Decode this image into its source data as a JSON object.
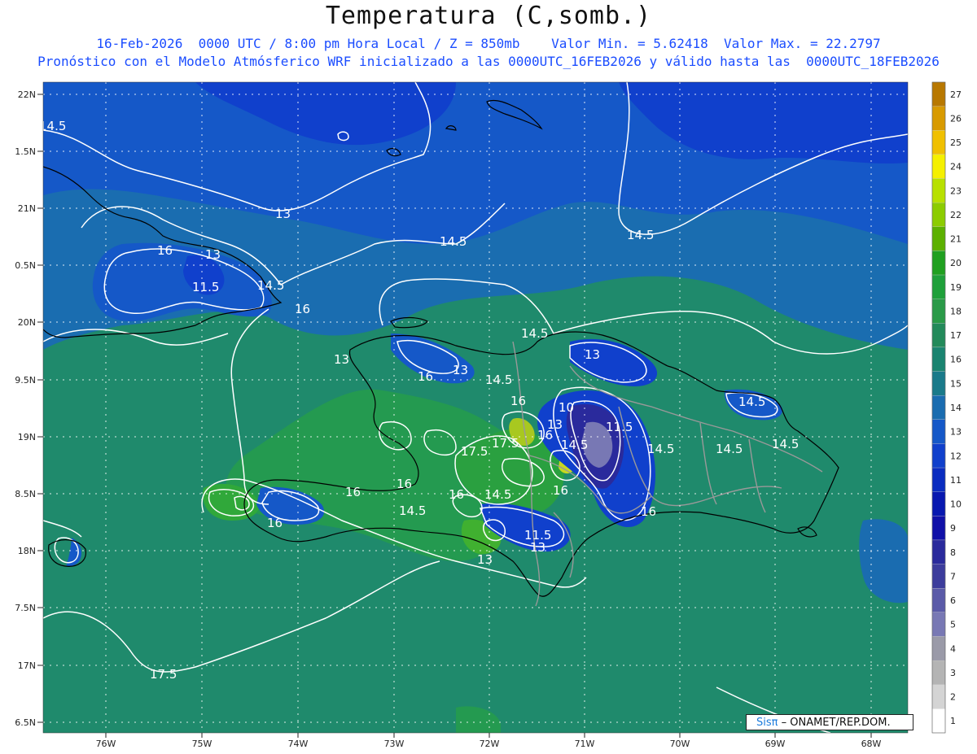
{
  "header": {
    "title": "Temperatura (C,somb.)",
    "line1": "16-Feb-2026  0000 UTC / 8:00 pm Hora Local / Z = 850mb    Valor Min. = 5.62418  Valor Max. = 22.2797",
    "line2": "Pronóstico con el Modelo Atmósferico WRF inicializado a las 0000UTC_16FEB2026 y válido hasta las  0000UTC_18FEB2026"
  },
  "axes": {
    "lat_labels": [
      "22N",
      "1.5N",
      "21N",
      "0.5N",
      "20N",
      "9.5N",
      "19N",
      "8.5N",
      "18N",
      "7.5N",
      "17N",
      "6.5N"
    ],
    "lon_labels": [
      "76W",
      "75W",
      "74W",
      "73W",
      "72W",
      "71W",
      "70W",
      "69W",
      "68W"
    ]
  },
  "colorbar": {
    "labels": [
      "27",
      "26",
      "25",
      "24",
      "23",
      "22",
      "21",
      "20",
      "19",
      "18",
      "17",
      "16",
      "15",
      "14",
      "13",
      "12",
      "11",
      "10",
      "9",
      "8",
      "7",
      "6",
      "5",
      "4",
      "3",
      "2",
      "1"
    ],
    "colors": [
      "#b87800",
      "#d89a00",
      "#f0c000",
      "#f5f000",
      "#b8e000",
      "#8ccc00",
      "#5cb000",
      "#20a020",
      "#1fa03a",
      "#2a9a48",
      "#238a5a",
      "#1a8470",
      "#1a7a8a",
      "#1a6cb0",
      "#1558c8",
      "#1040cc",
      "#0a2cc0",
      "#0818b0",
      "#1010a8",
      "#2a2a9c",
      "#3c3c9c",
      "#5a5aa8",
      "#7878b4",
      "#9a9aa8",
      "#b4b4b4",
      "#d4d4d4",
      "#ffffff"
    ]
  },
  "contour_labels": [
    "14.5",
    "13",
    "14.5",
    "13",
    "11.5",
    "14.5",
    "16",
    "13",
    "14.5",
    "16",
    "16",
    "14.5",
    "13",
    "16",
    "14.5",
    "13",
    "14.5",
    "10",
    "16",
    "13",
    "11.5",
    "17.5",
    "17.5",
    "14.5",
    "14.5",
    "14.5",
    "14.5",
    "16",
    "16",
    "14.5",
    "16",
    "16",
    "16",
    "11.5",
    "13",
    "13",
    "17.5",
    "16",
    "14.5"
  ],
  "credit": {
    "brand": "Sisπ",
    "text": "– ONAMET/REP.DOM."
  }
}
